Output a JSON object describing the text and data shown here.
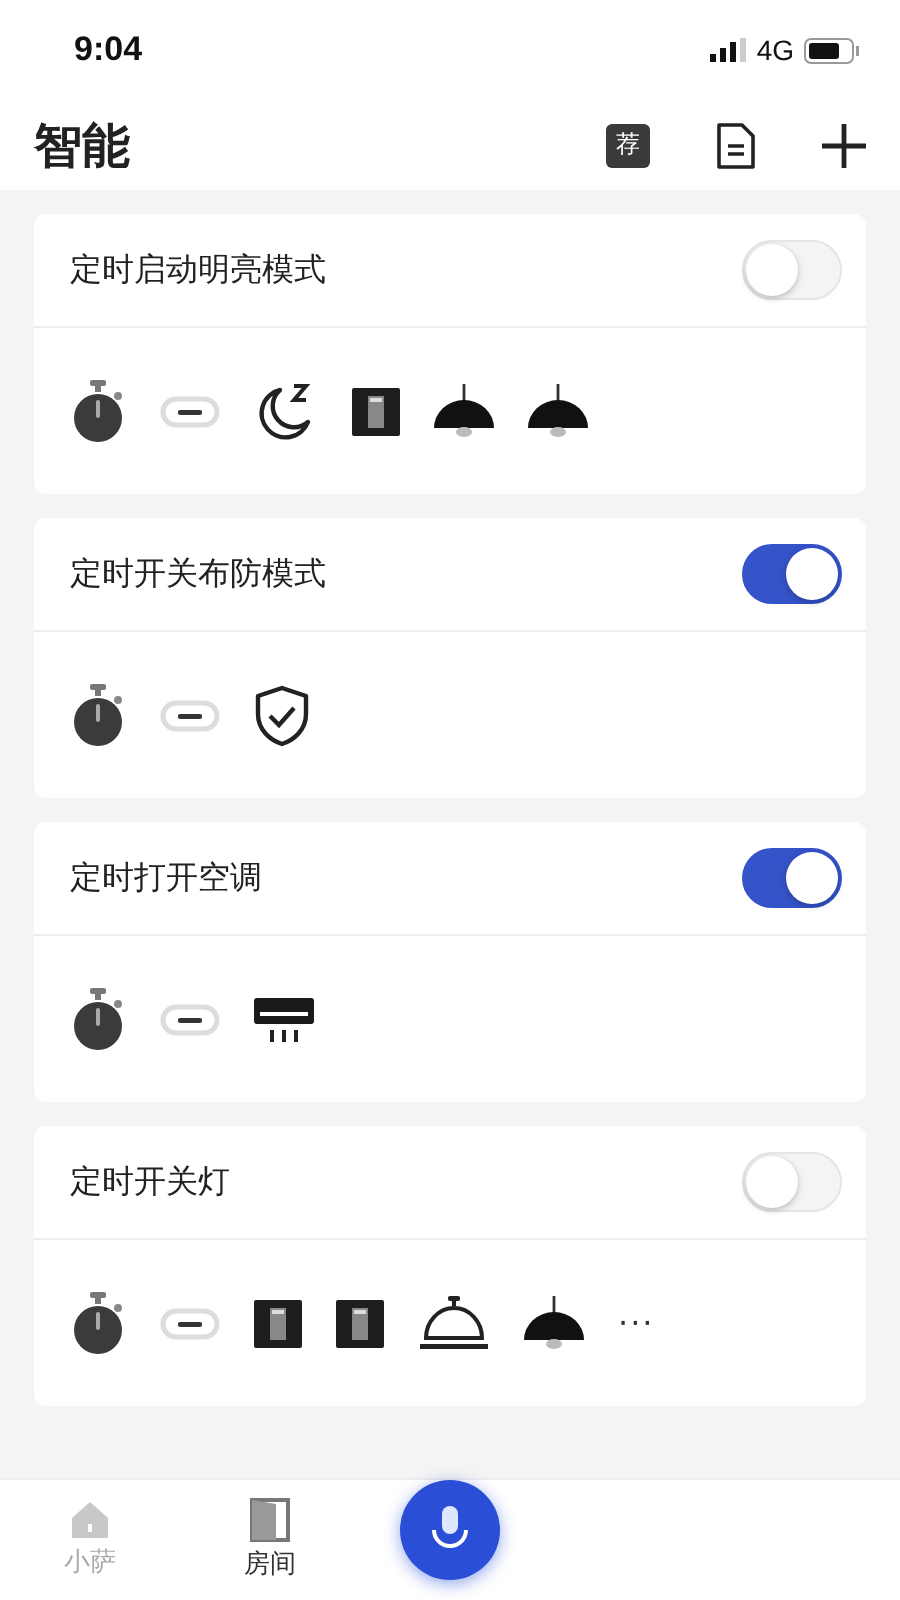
{
  "status_bar": {
    "time": "9:04",
    "network": "4G"
  },
  "header": {
    "title": "智能",
    "recommend_badge": "荐"
  },
  "scenes": [
    {
      "title": "定时启动明亮模式",
      "on": false,
      "devices": [
        {
          "kind": "timer"
        },
        {
          "kind": "link"
        },
        {
          "kind": "moon"
        },
        {
          "kind": "switch"
        },
        {
          "kind": "lamp"
        },
        {
          "kind": "lamp"
        }
      ]
    },
    {
      "title": "定时开关布防模式",
      "on": true,
      "devices": [
        {
          "kind": "timer"
        },
        {
          "kind": "link"
        },
        {
          "kind": "shield"
        }
      ]
    },
    {
      "title": "定时打开空调",
      "on": true,
      "devices": [
        {
          "kind": "timer"
        },
        {
          "kind": "link"
        },
        {
          "kind": "ac"
        }
      ]
    },
    {
      "title": "定时开关灯",
      "on": false,
      "devices": [
        {
          "kind": "timer"
        },
        {
          "kind": "link"
        },
        {
          "kind": "switch"
        },
        {
          "kind": "switch"
        },
        {
          "kind": "bell"
        },
        {
          "kind": "lamp"
        },
        {
          "kind": "more",
          "text": "···"
        }
      ]
    }
  ],
  "tab_bar": {
    "tabs": [
      {
        "label": "小萨",
        "kind": "home",
        "selected": false
      },
      {
        "label": "房间",
        "kind": "door",
        "selected": true
      }
    ]
  }
}
